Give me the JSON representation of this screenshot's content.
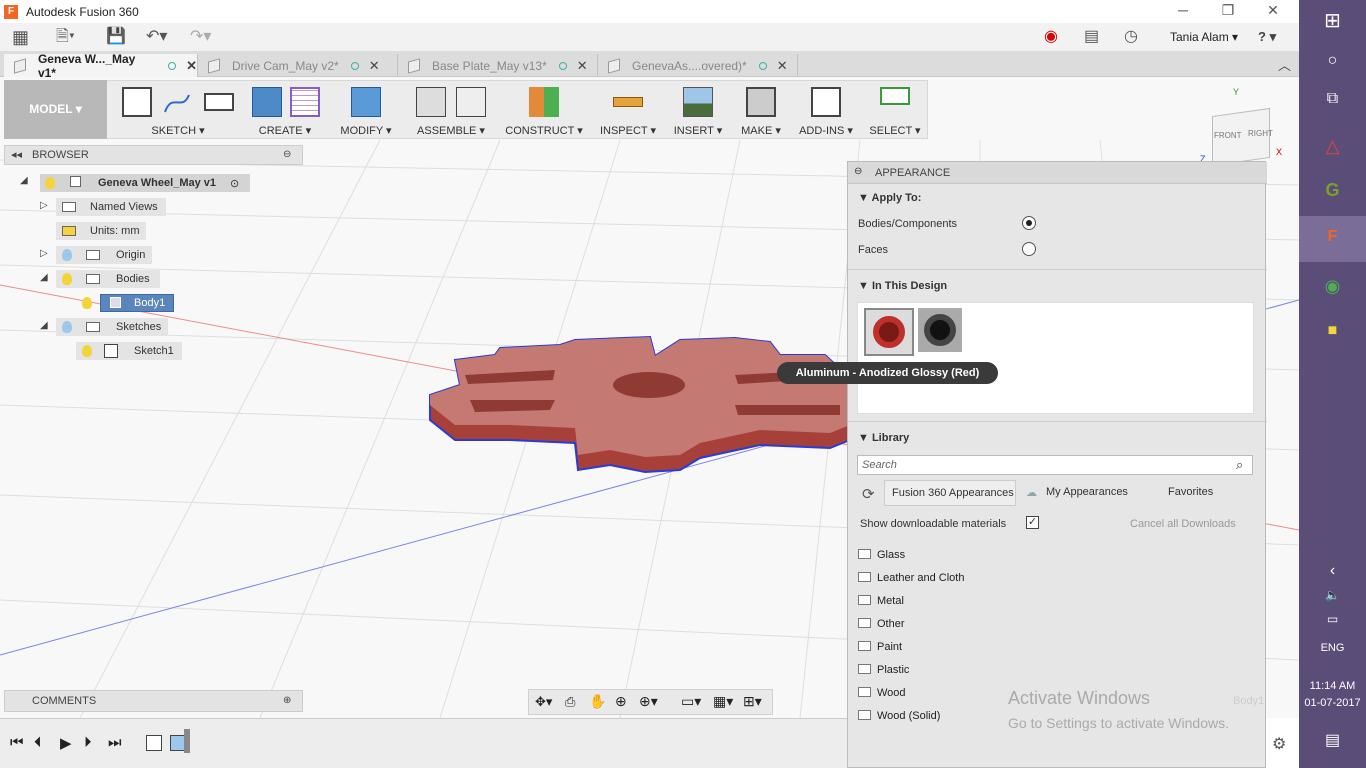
{
  "app": {
    "title": "Autodesk Fusion 360",
    "logo_letter": "F"
  },
  "window_controls": {
    "minimize": "─",
    "restore": "❐",
    "close": "✕"
  },
  "qat": {
    "user_name": "Tania Alam",
    "help_icon": "?"
  },
  "tabs": [
    {
      "label": "Geneva W..._May v1*",
      "active": true
    },
    {
      "label": "Drive Cam_May v2*",
      "active": false
    },
    {
      "label": "Base Plate_May v13*",
      "active": false
    },
    {
      "label": "GenevaAs....overed)*",
      "active": false
    }
  ],
  "toolbar": {
    "workspace": "MODEL ▾",
    "groups": [
      "SKETCH ▾",
      "CREATE ▾",
      "MODIFY ▾",
      "ASSEMBLE ▾",
      "CONSTRUCT ▾",
      "INSPECT ▾",
      "INSERT ▾",
      "MAKE ▾",
      "ADD-INS ▾",
      "SELECT ▾"
    ]
  },
  "viewcube": {
    "front": "FRONT",
    "right": "RIGHT",
    "axis_x": "X",
    "axis_y": "Y",
    "axis_z": "Z"
  },
  "browser": {
    "header": "BROWSER",
    "root": "Geneva Wheel_May v1",
    "items": {
      "named_views": "Named Views",
      "units": "Units: mm",
      "origin": "Origin",
      "bodies": "Bodies",
      "body1": "Body1",
      "sketches": "Sketches",
      "sketch1": "Sketch1"
    }
  },
  "appearance": {
    "header": "APPEARANCE",
    "apply_to_label": "Apply To:",
    "option_bodies": "Bodies/Components",
    "option_faces": "Faces",
    "selected_option": "Bodies/Components",
    "in_this_design": "In This Design",
    "tooltip": "Aluminum - Anodized Glossy (Red)",
    "library_label": "Library",
    "search_placeholder": "Search",
    "library_tabs": [
      "Fusion 360 Appearances",
      "My Appearances",
      "Favorites"
    ],
    "show_downloadable": "Show downloadable materials",
    "show_downloadable_checked": true,
    "cancel_downloads": "Cancel all Downloads",
    "folders": [
      "Glass",
      "Leather and Cloth",
      "Metal",
      "Other",
      "Paint",
      "Plastic",
      "Wood",
      "Wood (Solid)"
    ]
  },
  "comments": {
    "label": "COMMENTS"
  },
  "watermark": {
    "line1": "Activate Windows",
    "line2": "Go to Settings to activate Windows.",
    "ghost": "Body1"
  },
  "taskbar": {
    "language": "ENG",
    "time": "11:14 AM",
    "date": "01-07-2017"
  },
  "colors": {
    "accent_red": "#c0302b",
    "body_red": "#b5544c",
    "taskbar": "#5a4e78",
    "selection_blue": "#2a3bd8",
    "teal": "#3ab0a6"
  }
}
